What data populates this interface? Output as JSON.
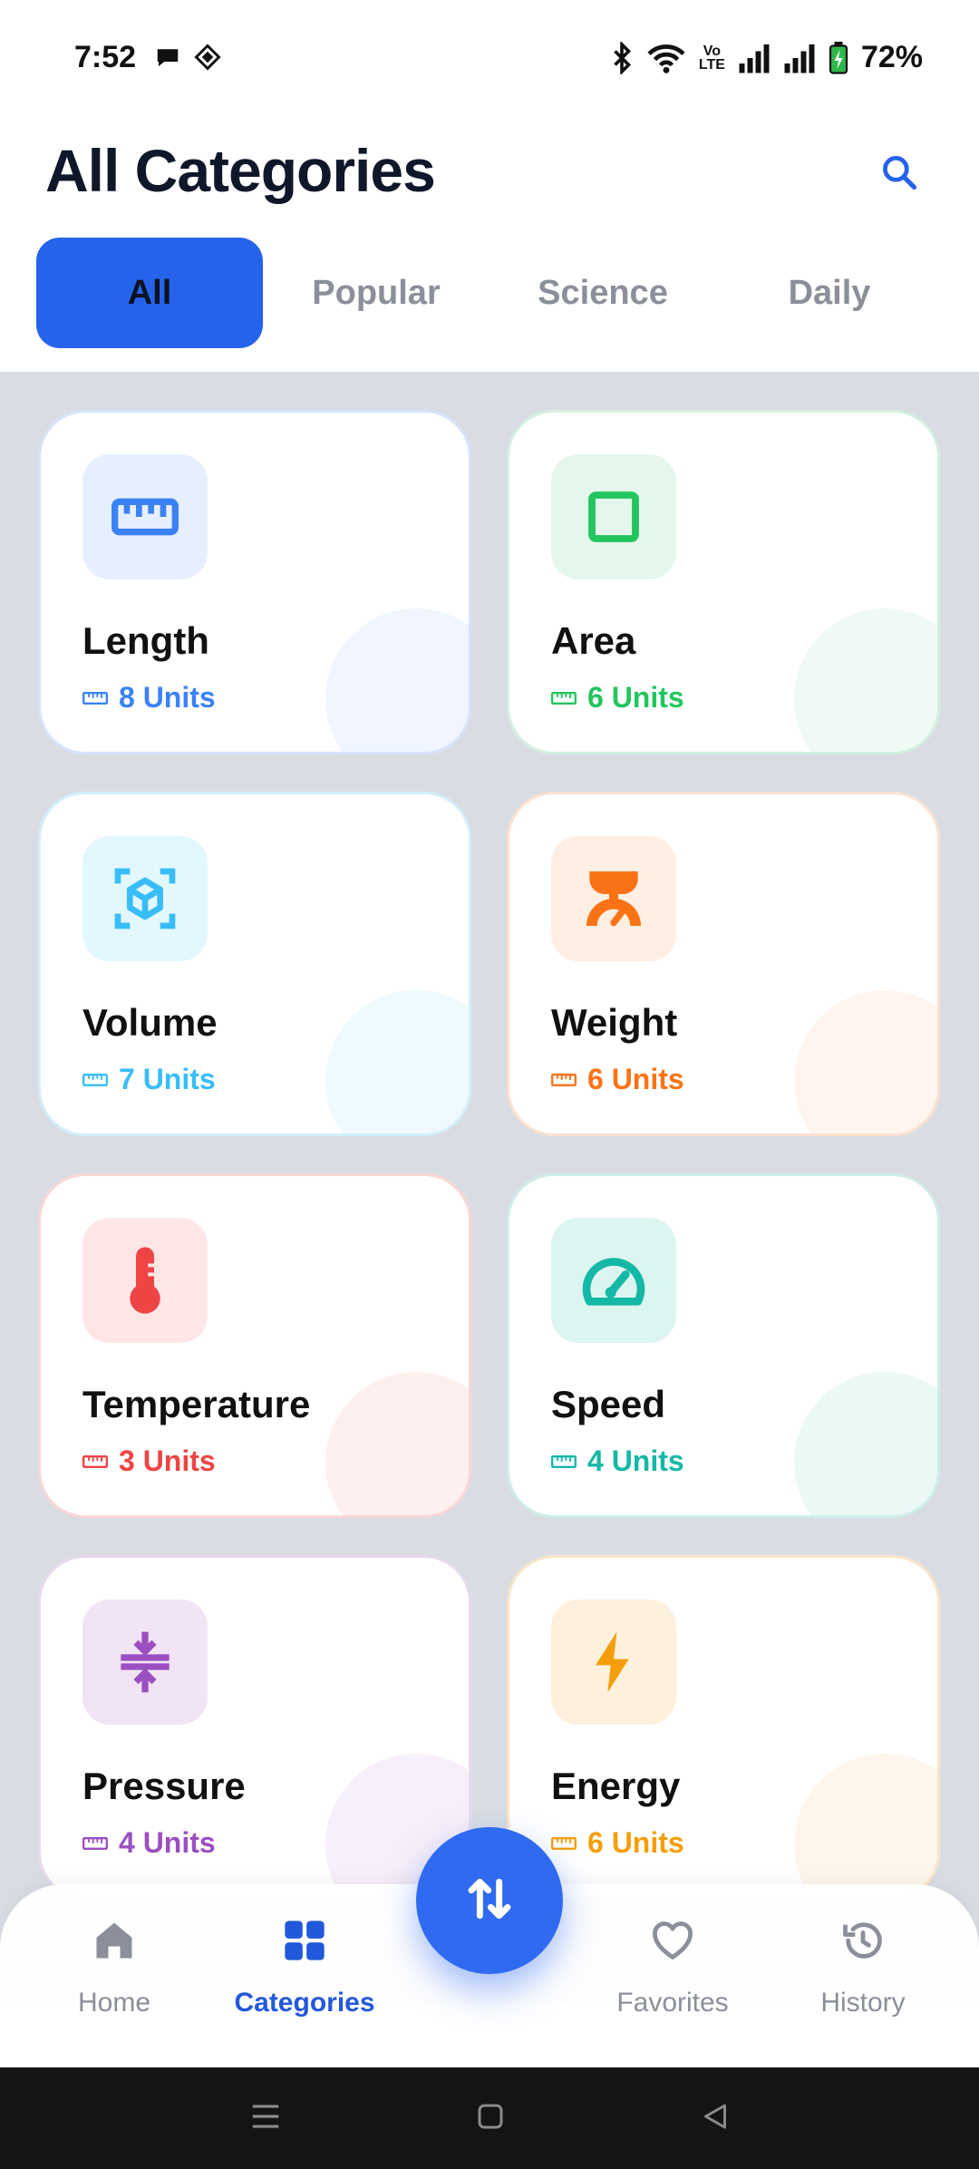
{
  "status_bar": {
    "time": "7:52",
    "battery": "72%",
    "volte_top": "Vo",
    "volte_bottom": "LTE",
    "icons": [
      "chat-bubble-icon",
      "app-diamond-icon",
      "bluetooth-icon",
      "wifi-icon",
      "volte-icon",
      "signal-icon",
      "signal-icon",
      "battery-charging-icon"
    ]
  },
  "header": {
    "title": "All Categories",
    "search_icon": "search-icon"
  },
  "tabs": [
    {
      "label": "All",
      "active": true
    },
    {
      "label": "Popular",
      "active": false
    },
    {
      "label": "Science",
      "active": false
    },
    {
      "label": "Daily",
      "active": false
    }
  ],
  "categories": [
    {
      "name": "Length",
      "units": "8 Units",
      "icon": "ruler-icon",
      "color": "#3b82f6",
      "tint": "#e6efff",
      "border": "#d6e3fb"
    },
    {
      "name": "Area",
      "units": "6 Units",
      "icon": "square-icon",
      "color": "#22c55e",
      "tint": "#e5f7ec",
      "border": "#d3f0df"
    },
    {
      "name": "Volume",
      "units": "7 Units",
      "icon": "cube-icon",
      "color": "#38bdf8",
      "tint": "#e3f7fe",
      "border": "#d2effb"
    },
    {
      "name": "Weight",
      "units": "6 Units",
      "icon": "scale-icon",
      "color": "#f97316",
      "tint": "#ffeee2",
      "border": "#fbe0cf"
    },
    {
      "name": "Temperature",
      "units": "3 Units",
      "icon": "thermometer-icon",
      "color": "#ef4444",
      "tint": "#ffe6e6",
      "border": "#fad6d6"
    },
    {
      "name": "Speed",
      "units": "4 Units",
      "icon": "speedometer-icon",
      "color": "#14b8a6",
      "tint": "#dcf5f0",
      "border": "#cdeee8"
    },
    {
      "name": "Pressure",
      "units": "4 Units",
      "icon": "compress-icon",
      "color": "#9b4fc0",
      "tint": "#f1e4f5",
      "border": "#e7d9ef"
    },
    {
      "name": "Energy",
      "units": "6 Units",
      "icon": "lightning-icon",
      "color": "#f59e0b",
      "tint": "#fdf0dc",
      "border": "#f9e4c7"
    }
  ],
  "bottom_nav": {
    "items": [
      {
        "label": "Home",
        "icon": "home-icon",
        "active": false
      },
      {
        "label": "Categories",
        "icon": "grid-icon",
        "active": true
      },
      {
        "label": "Favorites",
        "icon": "heart-icon",
        "active": false
      },
      {
        "label": "History",
        "icon": "history-icon",
        "active": false
      }
    ],
    "fab_icon": "swap-arrows-icon"
  },
  "system_nav": {
    "icons": [
      "menu-icon",
      "home-square-icon",
      "back-triangle-icon"
    ]
  },
  "colors": {
    "accent": "#2563eb",
    "title": "#0f172a",
    "inactive": "#8b8f99",
    "grid_bg": "#d9dde3"
  }
}
